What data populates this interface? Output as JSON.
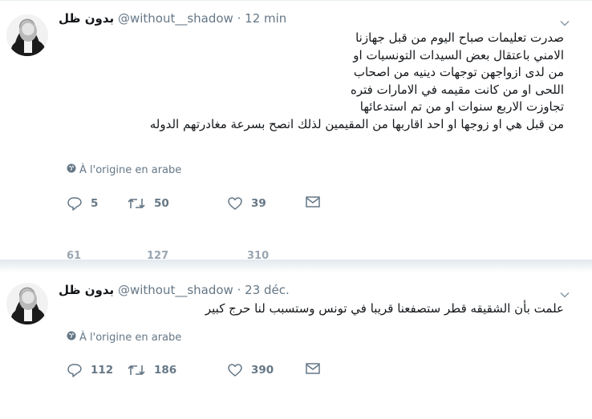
{
  "tweets": [
    {
      "display_name": "بدون ظل",
      "handle": "@without__shadow",
      "time": "· 12 min",
      "text": "صدرت تعليمات صباح اليوم من قبل جهازنا\nالامني باعتقال بعض السيدات التونسيات او\nمن لدى ازواجهن توجهات دينيه من اصحاب\nاللحى او من كانت مقيمه في الامارات فتره\nتجاوزت الاربع سنوات او من تم استدعائها\nمن قبل هي او زوجها او احد اقاربها من المقيمين لذلك انصح بسرعة مغادرتهم الدوله",
      "translation_note": "À l'origine en arabe",
      "replies": "5",
      "retweets": "50",
      "likes": "39"
    },
    {
      "display_name": "بدون ظل",
      "handle": "@without__shadow",
      "time": "· 23 déc.",
      "text": "علمت بأن الشقيقه قطر ستصفعنا قريبا في تونس وستسبب لنا حرج كبير",
      "translation_note": "À l'origine en arabe",
      "replies": "112",
      "retweets": "186",
      "likes": "390"
    }
  ],
  "partial_row": {
    "replies": "61",
    "retweets": "127",
    "likes": "310"
  },
  "colors": {
    "text": "#14171a",
    "muted": "#657786",
    "separator": "#e6ecf0"
  },
  "icons": [
    "globe-icon",
    "reply-icon",
    "retweet-icon",
    "like-icon",
    "direct-message-icon",
    "chevron-down-icon"
  ]
}
